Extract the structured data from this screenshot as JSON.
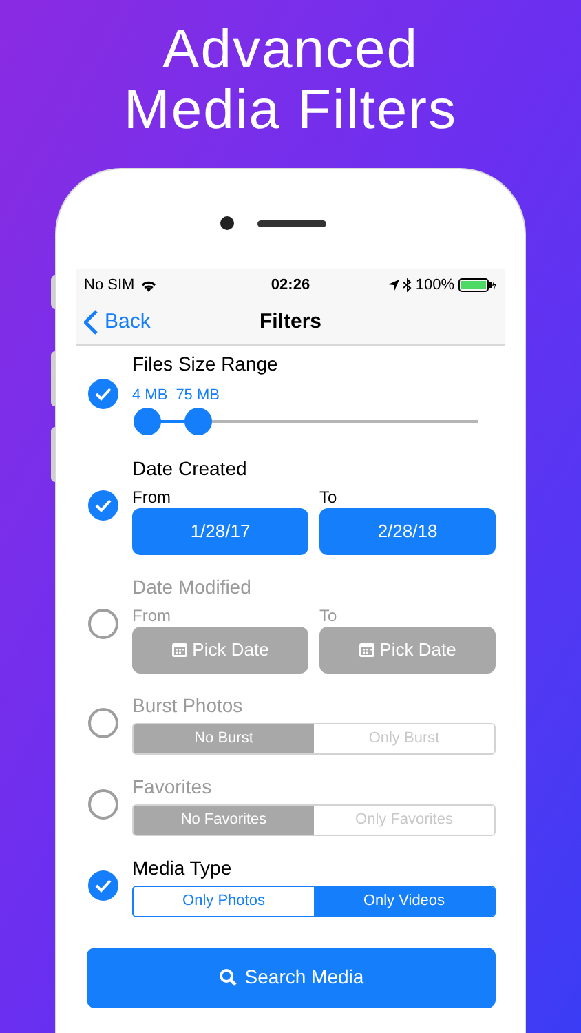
{
  "headline": [
    "Advanced",
    "Media Filters"
  ],
  "status_bar": {
    "carrier": "No SIM",
    "time": "02:26",
    "battery": "100%"
  },
  "nav": {
    "back": "Back",
    "title": "Filters"
  },
  "filters": [
    {
      "kind": "range",
      "title": "Files Size Range",
      "checked": true,
      "thumbs": [
        {
          "label": "4 MB",
          "level": 0.02
        },
        {
          "label": "75 MB",
          "level": 0.17
        }
      ]
    },
    {
      "kind": "date",
      "title": "Date Created",
      "checked": true,
      "fields": [
        {
          "label": "From",
          "value": "1/28/17"
        },
        {
          "label": "To",
          "value": "2/28/18"
        }
      ]
    },
    {
      "kind": "date",
      "title": "Date Modified",
      "checked": false,
      "fields": [
        {
          "label": "From",
          "placeholder": "Pick Date"
        },
        {
          "label": "To",
          "placeholder": "Pick Date"
        }
      ]
    },
    {
      "kind": "segmented",
      "title": "Burst Photos",
      "checked": false,
      "options": [
        {
          "label": "No Burst",
          "selected": true
        },
        {
          "label": "Only Burst",
          "selected": false
        }
      ]
    },
    {
      "kind": "segmented",
      "title": "Favorites",
      "checked": false,
      "options": [
        {
          "label": "No Favorites",
          "selected": true
        },
        {
          "label": "Only Favorites",
          "selected": false
        }
      ]
    },
    {
      "kind": "segmented",
      "title": "Media Type",
      "checked": true,
      "options": [
        {
          "label": "Only Photos",
          "selected": false
        },
        {
          "label": "Only Videos",
          "selected": true
        }
      ]
    }
  ],
  "search_button": "Search Media"
}
